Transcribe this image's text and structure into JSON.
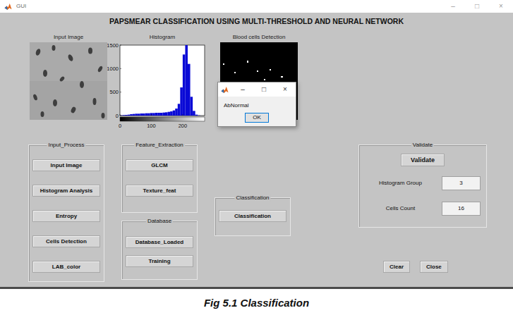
{
  "window": {
    "title": "GUI",
    "controls": [
      "–",
      "□",
      "×"
    ]
  },
  "heading": "PAPSMEAR CLASSIFICATION USING MULTI-THRESHOLD AND NEURAL NETWORK",
  "axes": {
    "input_image": {
      "label": "Input Image"
    },
    "histogram": {
      "label": "Histogram",
      "y_ticks": [
        "1500",
        "1000",
        "500",
        "0"
      ],
      "x_ticks": [
        "0",
        "100",
        "200"
      ],
      "values": [
        5,
        10,
        15,
        20,
        30,
        35,
        40,
        40,
        45,
        45,
        50,
        50,
        55,
        55,
        60,
        60,
        60,
        65,
        70,
        80,
        90,
        110,
        150,
        250,
        600,
        1300,
        1500,
        1100,
        400,
        100,
        20,
        5
      ]
    },
    "cells_detection": {
      "label": "Blood cells Detection"
    }
  },
  "panels": [
    {
      "title": "Input_Process",
      "buttons": [
        "Input Image",
        "Histogram Analysis",
        "Entropy",
        "Cells Detection",
        "LAB_color"
      ]
    },
    {
      "title": "Feature_Extraction",
      "buttons": [
        "GLCM",
        "Texture_feat"
      ]
    },
    {
      "title": "Database",
      "buttons": [
        "Database_Loaded",
        "Training"
      ]
    },
    {
      "title": "Classification",
      "buttons": [
        "Classification"
      ]
    }
  ],
  "validate": {
    "title": "Validate",
    "button": "Validate",
    "fields": [
      {
        "label": "Histogram Group",
        "value": "3"
      },
      {
        "label": "Cells Count",
        "value": "16"
      }
    ]
  },
  "actions": [
    "Clear",
    "Close"
  ],
  "dialog": {
    "controls": [
      "–",
      "□",
      "×"
    ],
    "message": "AbNormal",
    "button": "OK"
  },
  "caption": "Fig 5.1 Classification"
}
